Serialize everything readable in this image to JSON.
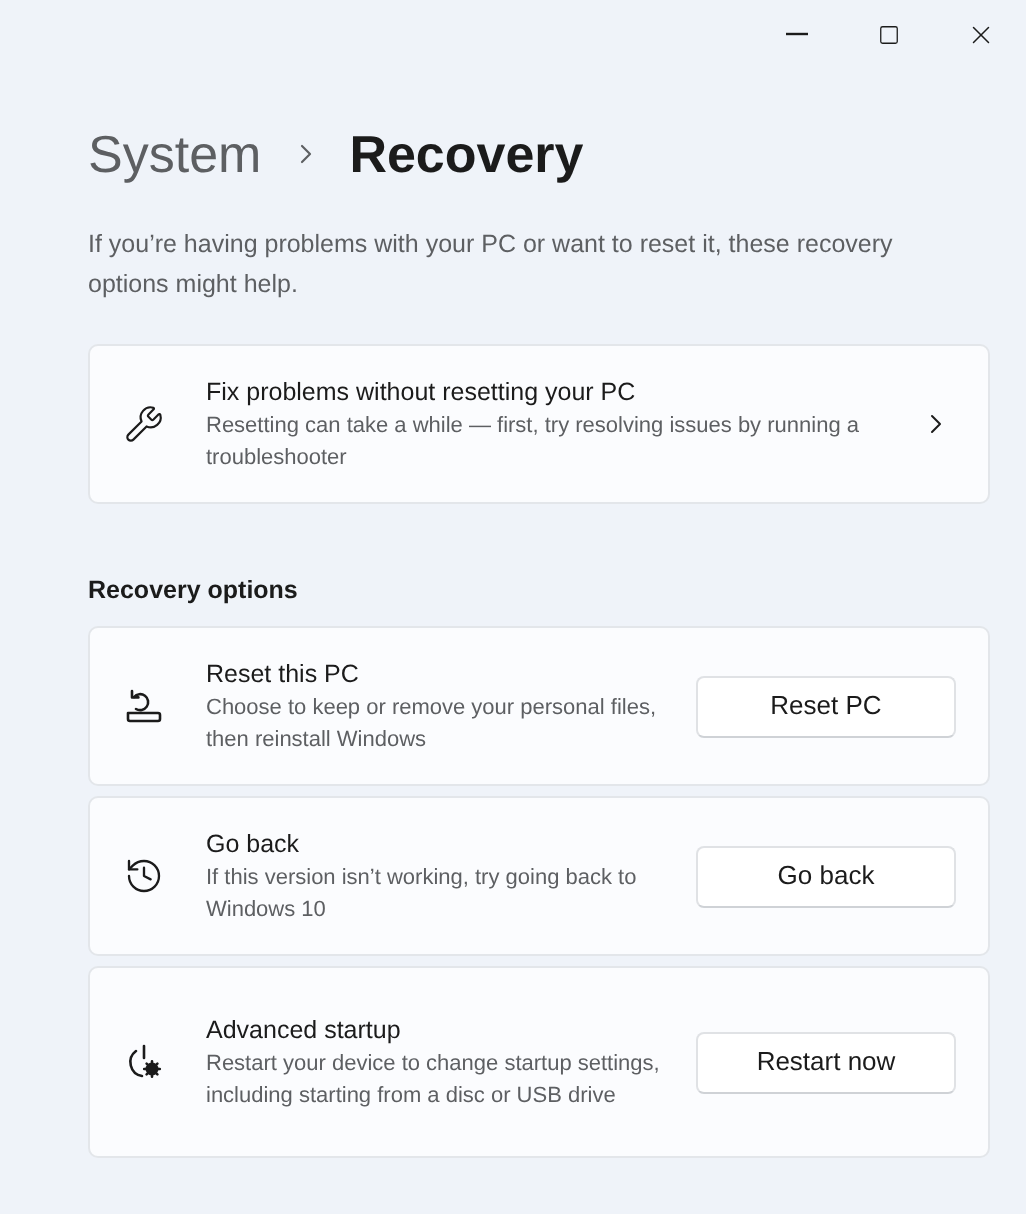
{
  "breadcrumb": {
    "parent": "System",
    "current": "Recovery"
  },
  "intro": "If you’re having problems with your PC or want to reset it, these recovery options might help.",
  "fix_card": {
    "title": "Fix problems without resetting your PC",
    "description": "Resetting can take a while — first, try resolving issues by running a troubleshooter"
  },
  "section_title": "Recovery options",
  "options": [
    {
      "kind": "reset",
      "title": "Reset this PC",
      "description": "Choose to keep or remove your personal files, then reinstall Windows",
      "button": "Reset PC"
    },
    {
      "kind": "history",
      "title": "Go back",
      "description": "If this version isn’t working, try going back to Windows 10",
      "button": "Go back"
    },
    {
      "kind": "startup",
      "title": "Advanced startup",
      "description": "Restart your device to change startup settings, including starting from a disc or USB drive",
      "button": "Restart now"
    }
  ]
}
